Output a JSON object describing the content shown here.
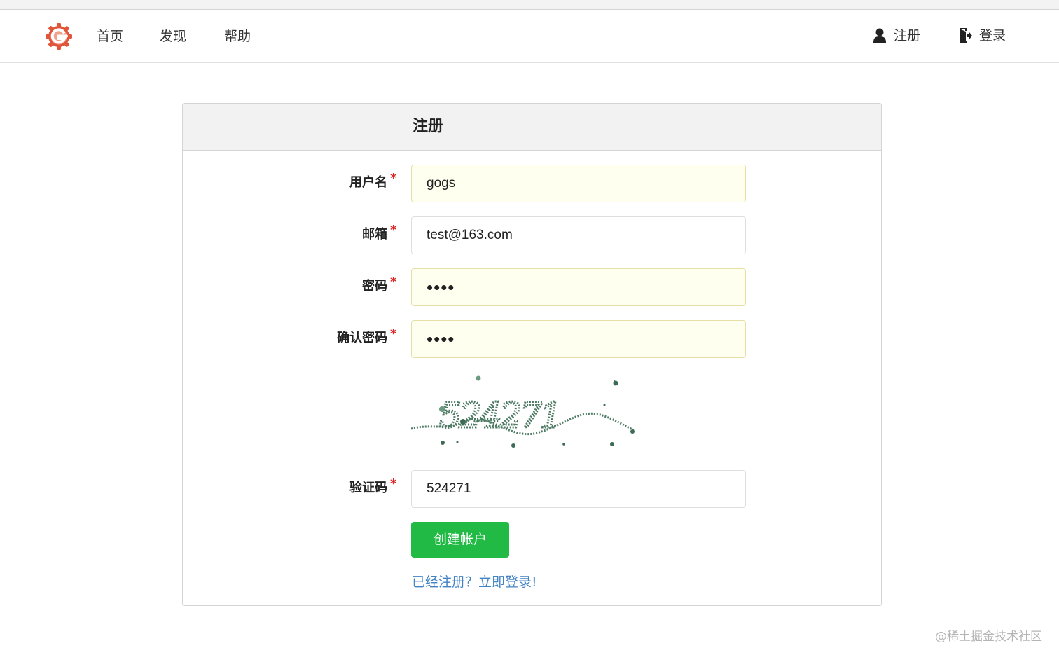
{
  "navbar": {
    "links": [
      "首页",
      "发现",
      "帮助"
    ],
    "register_label": "注册",
    "login_label": "登录"
  },
  "form": {
    "title": "注册",
    "username": {
      "label": "用户名",
      "value": "gogs"
    },
    "email": {
      "label": "邮箱",
      "value": "test@163.com"
    },
    "password": {
      "label": "密码",
      "value": "••••"
    },
    "confirm_password": {
      "label": "确认密码",
      "value": "••••"
    },
    "captcha": {
      "label": "验证码",
      "image_text": "524271",
      "value": "524271"
    },
    "submit_label": "创建帐户",
    "signin_link": "已经注册？立即登录!"
  },
  "watermark": "@稀土掘金技术社区",
  "colors": {
    "primary_button": "#21ba45",
    "link": "#4183c4",
    "required": "#db2828",
    "autofill_bg": "#fffff0"
  }
}
